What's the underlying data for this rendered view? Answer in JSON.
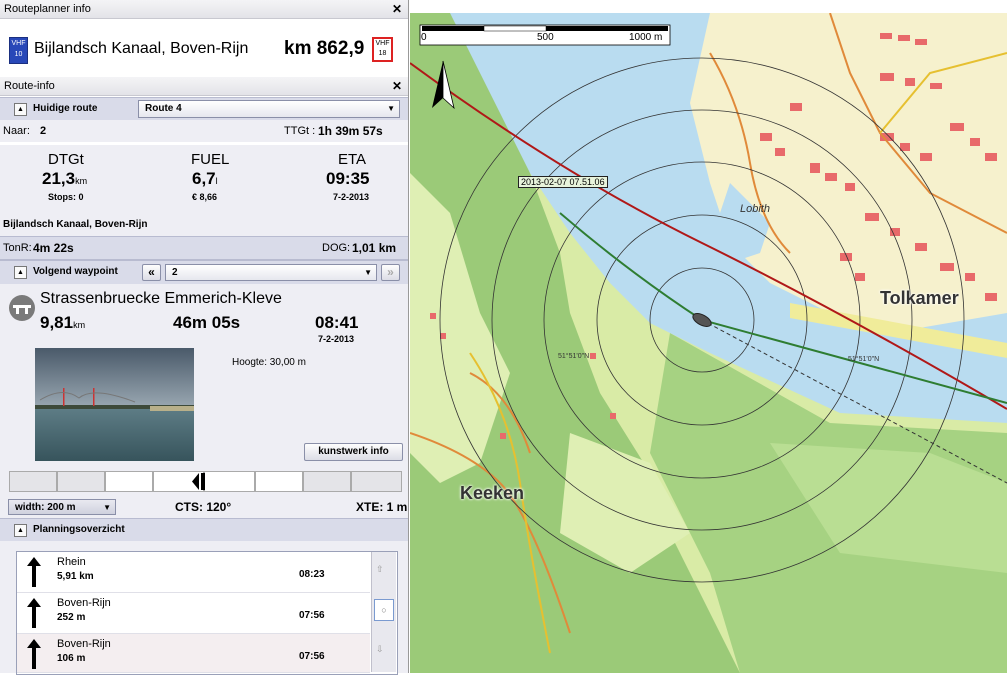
{
  "panel": {
    "routeplanner_header": "Routeplanner info",
    "vhf_left_line1": "VHF",
    "vhf_left_line2": "10",
    "location_title": "Bijlandsch Kanaal, Boven-Rijn",
    "km_value": "km 862,9",
    "vhf_right_line1": "VHF",
    "vhf_right_line2": "18",
    "routeinfo_header": "Route-info",
    "current_route_label": "Huidige route",
    "current_route_value": "Route 4",
    "naar_label": "Naar:",
    "naar_value": "2",
    "ttgt_label": "TTGt :",
    "ttgt_value": "1h 39m 57s",
    "stats": {
      "dtgt_caption": "DTGt",
      "dtgt_value": "21,3",
      "dtgt_unit": "km",
      "stops": "Stops: 0",
      "fuel_caption": "FUEL",
      "fuel_value": "6,7",
      "fuel_unit": "l",
      "fuel_cost": "€ 8,66",
      "eta_caption": "ETA",
      "eta_value": "09:35",
      "eta_date": "7-2-2013"
    },
    "destination_name": "Bijlandsch Kanaal, Boven-Rijn",
    "tonr_label": "TonR:",
    "tonr_value": "4m 22s",
    "dog_label": "DOG:",
    "dog_value": "1,01 km",
    "next_waypoint_label": "Volgend waypoint",
    "prev_btn": "«",
    "next_btn": "»",
    "waypoint_value": "2",
    "waypoint_name": "Strassenbruecke Emmerich-Kleve",
    "wp_distance": "9,81",
    "wp_distance_unit": "km",
    "wp_time": "46m 05s",
    "wp_eta": "08:41",
    "wp_eta_date": "7-2-2013",
    "hoogte": "Hoogte: 30,00 m",
    "kunstwerk_btn": "kunstwerk info",
    "width_value": "width: 200 m",
    "cts": "CTS: 120°",
    "xte": "XTE: 1 m",
    "planning_label": "Planningsoverzicht",
    "planning_rows": [
      {
        "name": "Rhein",
        "dist": "5,91 km",
        "time": "08:23"
      },
      {
        "name": "Boven-Rijn",
        "dist": "252 m",
        "time": "07:56"
      },
      {
        "name": "Boven-Rijn",
        "dist": "106 m",
        "time": "07:56"
      }
    ]
  },
  "map": {
    "scale_labels": [
      "0",
      "500",
      "1000 m"
    ],
    "timestamp_label": "2013-02-07 07.51.06",
    "place_tolkamer": "Tolkamer",
    "place_keeken": "Keeken",
    "place_lobith": "Lobith",
    "lat_label": "51°51'0\"N",
    "colors": {
      "water": "#b9dcf0",
      "land": "#d9eba6",
      "forest": "#8fbf6a",
      "route_red": "#b01818",
      "route_green": "#2e7d32"
    }
  }
}
